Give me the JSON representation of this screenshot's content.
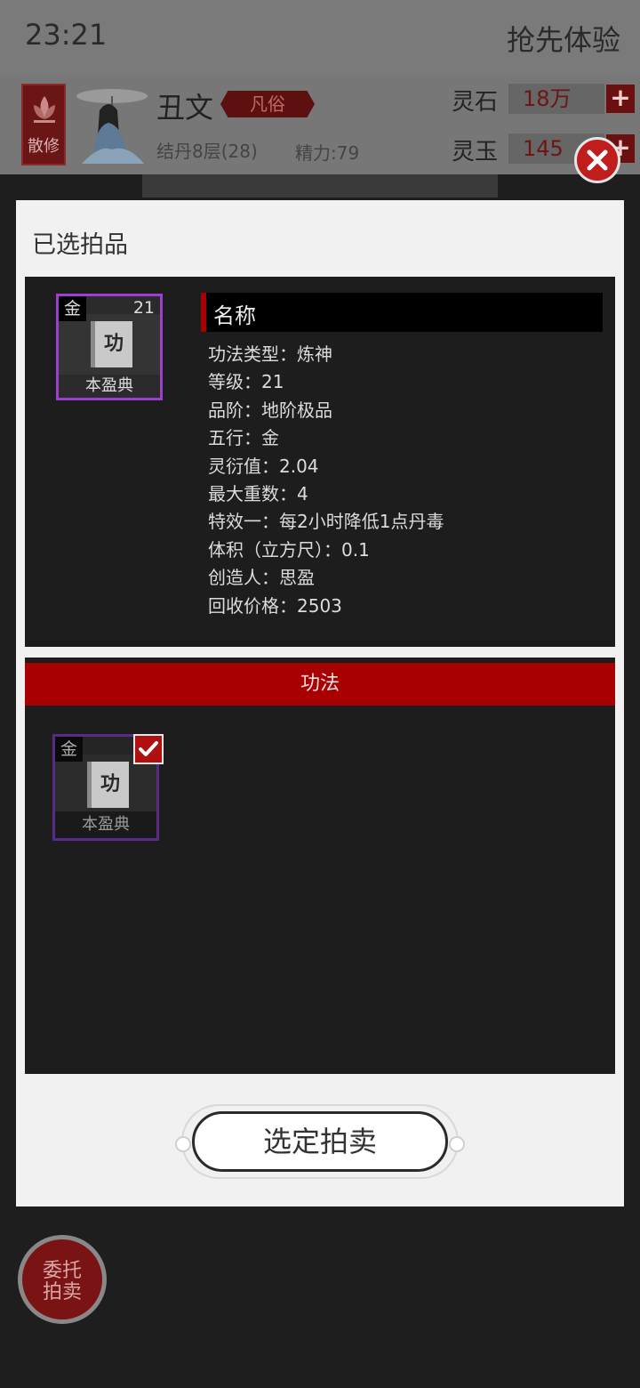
{
  "status_bar": {
    "time": "23:21",
    "right_text": "抢先体验"
  },
  "player": {
    "sect": "散修",
    "name": "丑文",
    "rank": "凡俗",
    "realm": "结丹8层(28)",
    "energy": "精力:79"
  },
  "resources": [
    {
      "label": "灵石",
      "value": "18万"
    },
    {
      "label": "灵玉",
      "value": "145"
    }
  ],
  "dialog": {
    "title": "已选拍品",
    "selected_item": {
      "element": "金",
      "level": "21",
      "icon_char": "功",
      "name": "本盈典",
      "name_bar": "名称",
      "attributes": [
        "功法类型：炼神",
        "等级：21",
        "品阶：地阶极品",
        "五行：金",
        "灵衍值：2.04",
        "最大重数：4",
        "特效一：每2小时降低1点丹毒",
        "体积（立方尺）：0.1",
        "创造人：思盈",
        "回收价格：2503"
      ]
    },
    "category": "功法",
    "list_items": [
      {
        "element": "金",
        "icon_char": "功",
        "name": "本盈典",
        "selected": true
      }
    ],
    "confirm_label": "选定拍卖"
  },
  "fab": {
    "line1": "委托",
    "line2": "拍卖"
  },
  "colors": {
    "accent_red": "#a80000",
    "rarity_purple": "#9c3fd0",
    "panel_bg": "#1d1d1d",
    "dialog_bg": "#f1f1f1"
  }
}
